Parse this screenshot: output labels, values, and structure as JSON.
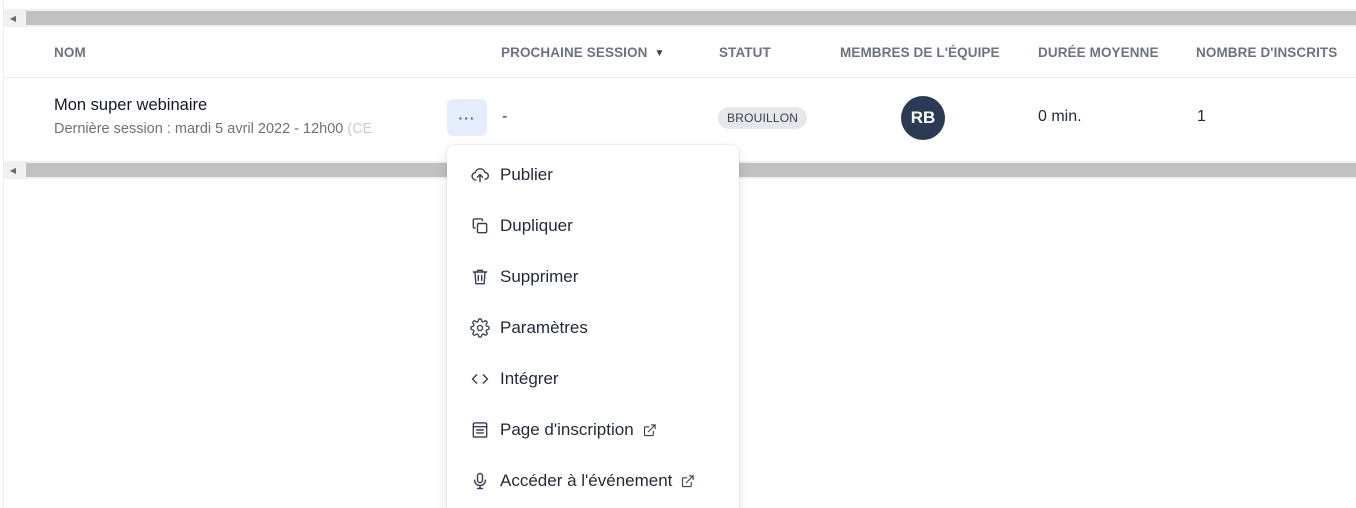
{
  "table": {
    "columns": {
      "name": "NOM",
      "next_session": "PROCHAINE SESSION",
      "status": "STATUT",
      "team_members": "MEMBRES DE L'ÉQUIPE",
      "avg_duration": "DURÉE MOYENNE",
      "registrants": "NOMBRE D'INSCRITS"
    },
    "sort": {
      "column": "next_session",
      "direction": "desc",
      "icon": "caret-down-icon"
    },
    "rows": [
      {
        "title": "Mon super webinaire",
        "subtitle": "Dernière session : mardi 5 avril 2022 - 12h00",
        "subtitle_fade": " (CE",
        "more_label": "···",
        "next_session": "-",
        "status": "BROUILLON",
        "avatar_initials": "RB",
        "avg_duration": "0 min.",
        "registrants": "1"
      }
    ]
  },
  "menu": {
    "items": [
      {
        "label": "Publier",
        "icon": "cloud-upload-icon",
        "external": false
      },
      {
        "label": "Dupliquer",
        "icon": "copy-icon",
        "external": false
      },
      {
        "label": "Supprimer",
        "icon": "trash-icon",
        "external": false
      },
      {
        "label": "Paramètres",
        "icon": "gear-icon",
        "external": false
      },
      {
        "label": "Intégrer",
        "icon": "code-icon",
        "external": false
      },
      {
        "label": "Page d'inscription",
        "icon": "form-page-icon",
        "external": true
      },
      {
        "label": "Accéder à l'événement",
        "icon": "microphone-icon",
        "external": true
      }
    ]
  },
  "colors": {
    "accent": "#2f5fd0",
    "accent_bg": "#e5edfb",
    "avatar_bg": "#2b3a55",
    "badge_bg": "#e6e7ea",
    "header_text": "#6b7280"
  }
}
